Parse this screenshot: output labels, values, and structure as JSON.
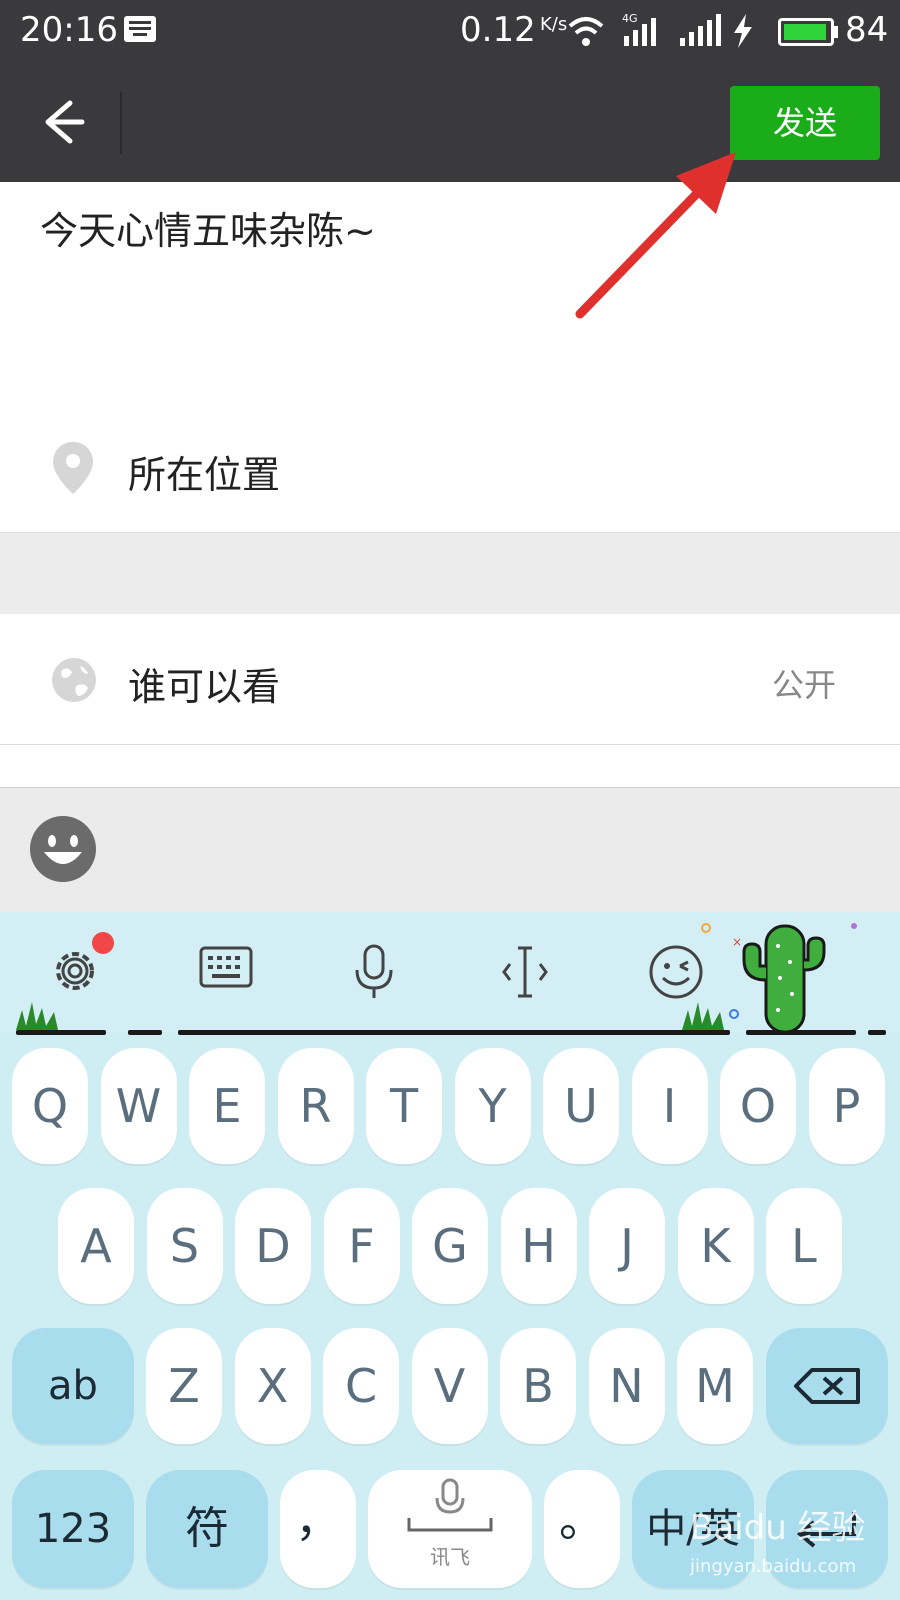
{
  "status_bar": {
    "time": "20:16",
    "net_speed": "0.12",
    "net_speed_unit": "K/s",
    "network_type": "4G",
    "battery": "84",
    "icons": [
      "keyboard-icon",
      "wifi-icon",
      "signal-4g-icon",
      "signal-icon",
      "charging-icon",
      "battery-icon"
    ]
  },
  "header": {
    "back_icon": "back-arrow-icon",
    "send_label": "发送"
  },
  "post": {
    "text": "今天心情五味杂陈~"
  },
  "location": {
    "icon": "location-pin-icon",
    "label": "所在位置"
  },
  "visibility": {
    "icon": "globe-icon",
    "label": "谁可以看",
    "value": "公开"
  },
  "emoji_bar": {
    "icon": "smiley-face-icon"
  },
  "keyboard": {
    "toolbar_icons": [
      "settings-icon",
      "keyboard-icon",
      "microphone-icon",
      "cursor-icon",
      "emoji-wink-icon"
    ],
    "row1": [
      "Q",
      "W",
      "E",
      "R",
      "T",
      "Y",
      "U",
      "I",
      "O",
      "P"
    ],
    "row2": [
      "A",
      "S",
      "D",
      "F",
      "G",
      "H",
      "J",
      "K",
      "L"
    ],
    "row3_shift": "ab",
    "row3": [
      "Z",
      "X",
      "C",
      "V",
      "B",
      "N",
      "M"
    ],
    "row4": {
      "num": "123",
      "symbol": "符",
      "comma": "，",
      "space_label": "讯飞",
      "period": "。",
      "lang": "中/英"
    }
  },
  "colors": {
    "send_green": "#1aad19",
    "bar_dark": "#3a3a3c",
    "keyboard_bg": "#cfeef3",
    "arrow_red": "#e0302e"
  },
  "watermark": {
    "text": "Baidu 经验",
    "sub": "jingyan.baidu.com"
  }
}
